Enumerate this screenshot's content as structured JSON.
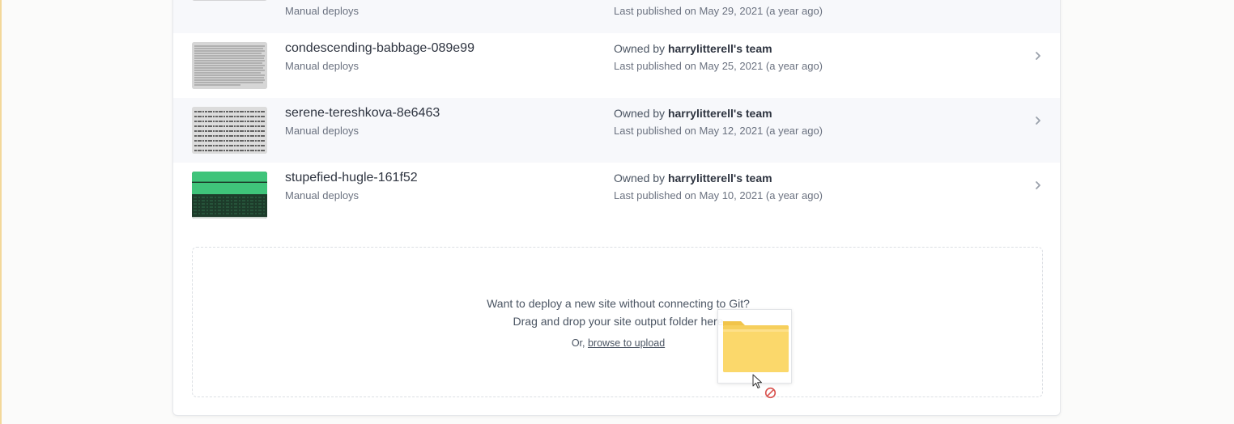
{
  "sites": [
    {
      "name": "",
      "deploy_type": "Manual deploys",
      "owner_prefix": "",
      "owner_team": "",
      "published": "Last published on May 29, 2021 (a year ago)",
      "thumbnail": "gray"
    },
    {
      "name": "condescending-babbage-089e99",
      "deploy_type": "Manual deploys",
      "owner_prefix": "Owned by",
      "owner_team": "harrylitterell's team",
      "published": "Last published on May 25, 2021 (a year ago)",
      "thumbnail": "text-dense"
    },
    {
      "name": "serene-tereshkova-8e6463",
      "deploy_type": "Manual deploys",
      "owner_prefix": "Owned by",
      "owner_team": "harrylitterell's team",
      "published": "Last published on May 12, 2021 (a year ago)",
      "thumbnail": "lorem-text"
    },
    {
      "name": "stupefied-hugle-161f52",
      "deploy_type": "Manual deploys",
      "owner_prefix": "Owned by",
      "owner_team": "harrylitterell's team",
      "published": "Last published on May 10, 2021 (a year ago)",
      "thumbnail": "green-dark"
    }
  ],
  "dropzone": {
    "line1": "Want to deploy a new site without connecting to Git?",
    "line2": "Drag and drop your site output folder here",
    "or_prefix": "Or,",
    "browse_link": "browse to upload"
  },
  "icons": {
    "row_arrow": "chevron-right-icon",
    "dragged_item": "folder-icon",
    "cursor": "mouse-cursor-icon",
    "drop_status": "no-drop-icon"
  },
  "colors": {
    "folder_yellow": "#f6cf5c",
    "thumb_green": "#3fc47a",
    "thumb_dark": "#1d3b2a",
    "no_drop_red": "#d9534f"
  }
}
